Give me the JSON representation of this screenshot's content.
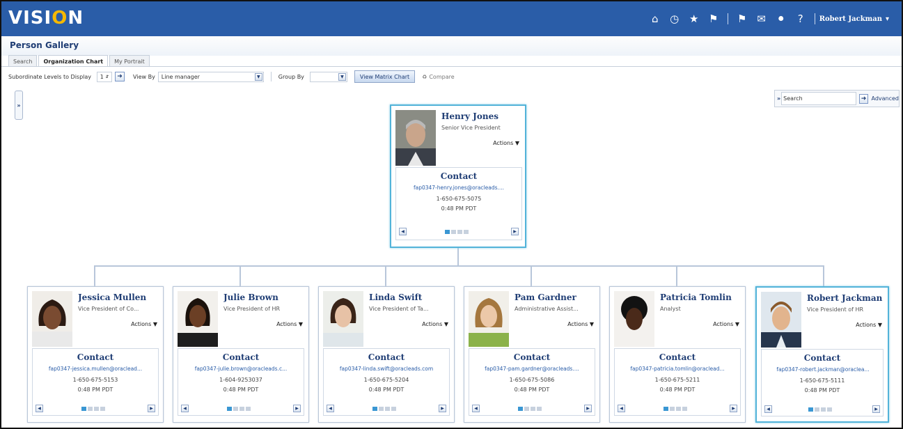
{
  "app": {
    "logo_prefix": "VISI",
    "logo_o": "O",
    "logo_suffix": "N",
    "accent": "#2a5da8",
    "highlight": "#52b3d9"
  },
  "header": {
    "icons": [
      "home-icon",
      "recent-icon",
      "favorites-icon",
      "flag-icon",
      "notifications-icon",
      "messages-icon",
      "accessibility-icon",
      "help-icon"
    ],
    "user_name": "Robert Jackman",
    "user_caret": "▾"
  },
  "page": {
    "title": "Person Gallery",
    "tabs": [
      {
        "label": "Search",
        "active": false
      },
      {
        "label": "Organization Chart",
        "active": true
      },
      {
        "label": "My Portrait",
        "active": false
      }
    ]
  },
  "toolbar": {
    "levels_label": "Subordinate Levels to Display",
    "levels_value": "1",
    "view_by_label": "View By",
    "view_by_value": "Line manager",
    "group_by_label": "Group By",
    "group_by_value": "",
    "matrix_button": "View Matrix Chart",
    "compare_label": "Compare"
  },
  "search": {
    "placeholder": "Search",
    "advanced_label": "Advanced"
  },
  "common": {
    "actions_label": "Actions",
    "contact_label": "Contact"
  },
  "manager": {
    "name": "Henry Jones",
    "title": "Senior Vice President",
    "email": "fap0347-henry.jones@oracleads....",
    "phone": "1-650-675-5075",
    "time": "0:48 PM PDT"
  },
  "reports": [
    {
      "name": "Jessica Mullen",
      "title": "Vice President of Co...",
      "email": "fap0347-jessica.mullen@oraclead...",
      "phone": "1-650-675-5153",
      "time": "0:48 PM PDT",
      "highlighted": false
    },
    {
      "name": "Julie Brown",
      "title": "Vice President of HR",
      "email": "fap0347-julie.brown@oracleads.c...",
      "phone": "1-604-9253037",
      "time": "0:48 PM PDT",
      "highlighted": false
    },
    {
      "name": "Linda Swift",
      "title": "Vice President of Ta...",
      "email": "fap0347-linda.swift@oracleads.com",
      "phone": "1-650-675-5204",
      "time": "0:48 PM PDT",
      "highlighted": false
    },
    {
      "name": "Pam Gardner",
      "title": "Administrative Assist...",
      "email": "fap0347-pam.gardner@oracleads....",
      "phone": "1-650-675-5086",
      "time": "0:48 PM PDT",
      "highlighted": false
    },
    {
      "name": "Patricia Tomlin",
      "title": "Analyst",
      "email": "fap0347-patricia.tomlin@oraclead...",
      "phone": "1-650-675-5211",
      "time": "0:48 PM PDT",
      "highlighted": false
    },
    {
      "name": "Robert Jackman",
      "title": "Vice President of HR",
      "email": "fap0347-robert.jackman@oraclea...",
      "phone": "1-650-675-5111",
      "time": "0:48 PM PDT",
      "highlighted": true
    }
  ]
}
